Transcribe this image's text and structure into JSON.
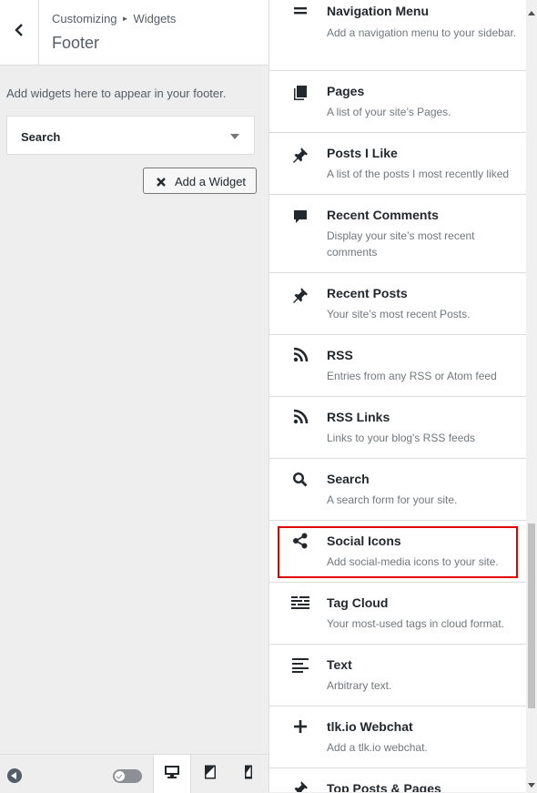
{
  "customizer": {
    "breadcrumb_root": "Customizing",
    "breadcrumb_section": "Widgets",
    "title": "Footer",
    "description": "Add widgets here to appear in your footer.",
    "widgets": [
      {
        "title": "Search"
      }
    ],
    "add_widget_label": "Add a Widget"
  },
  "available_widgets": [
    {
      "name": "Navigation Menu",
      "desc": "Add a navigation menu to your sidebar.",
      "icon": "menu-icon"
    },
    {
      "name": "Pages",
      "desc": "A list of your site’s Pages.",
      "icon": "pages-icon"
    },
    {
      "name": "Posts I Like",
      "desc": "A list of the posts I most recently liked",
      "icon": "pin-icon"
    },
    {
      "name": "Recent Comments",
      "desc": "Display your site’s most recent comments",
      "icon": "comment-icon"
    },
    {
      "name": "Recent Posts",
      "desc": "Your site’s most recent Posts.",
      "icon": "pin-icon"
    },
    {
      "name": "RSS",
      "desc": "Entries from any RSS or Atom feed",
      "icon": "rss-icon"
    },
    {
      "name": "RSS Links",
      "desc": "Links to your blog's RSS feeds",
      "icon": "rss-icon"
    },
    {
      "name": "Search",
      "desc": "A search form for your site.",
      "icon": "search-icon"
    },
    {
      "name": "Social Icons",
      "desc": "Add social-media icons to your site.",
      "icon": "share-icon"
    },
    {
      "name": "Tag Cloud",
      "desc": "Your most-used tags in cloud format.",
      "icon": "tag-cloud-icon"
    },
    {
      "name": "Text",
      "desc": "Arbitrary text.",
      "icon": "text-icon"
    },
    {
      "name": "tlk.io Webchat",
      "desc": "Add a tlk.io webchat.",
      "icon": "plus-icon"
    },
    {
      "name": "Top Posts & Pages",
      "desc": "",
      "icon": "pin-icon"
    }
  ],
  "highlighted_widget": "Social Icons",
  "colors": {
    "highlight": "#e00000",
    "panel_bg": "#eeeeee"
  }
}
